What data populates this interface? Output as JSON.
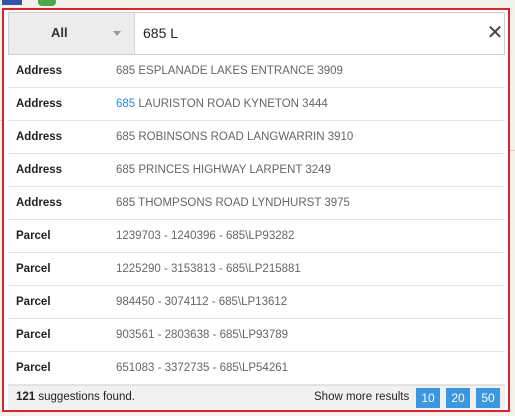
{
  "search": {
    "filter_label": "All",
    "query": "685 L",
    "clear_glyph": "✕"
  },
  "suggestions": [
    {
      "type": "Address",
      "match": "",
      "rest": "685 ESPLANADE LAKES ENTRANCE 3909"
    },
    {
      "type": "Address",
      "match": "685",
      "rest": " LAURISTON ROAD KYNETON 3444"
    },
    {
      "type": "Address",
      "match": "",
      "rest": "685 ROBINSONS ROAD LANGWARRIN 3910"
    },
    {
      "type": "Address",
      "match": "",
      "rest": "685 PRINCES HIGHWAY LARPENT 3249"
    },
    {
      "type": "Address",
      "match": "",
      "rest": "685 THOMPSONS ROAD LYNDHURST 3975"
    },
    {
      "type": "Parcel",
      "match": "",
      "rest": "1239703 - 1240396 - 685\\LP93282"
    },
    {
      "type": "Parcel",
      "match": "",
      "rest": "1225290 - 3153813 - 685\\LP215881"
    },
    {
      "type": "Parcel",
      "match": "",
      "rest": "984450 - 3074112 - 685\\LP13612"
    },
    {
      "type": "Parcel",
      "match": "",
      "rest": "903561 - 2803638 - 685\\LP93789"
    },
    {
      "type": "Parcel",
      "match": "",
      "rest": "651083 - 3372735 - 685\\LP54261"
    }
  ],
  "footer": {
    "count": "121",
    "count_suffix": " suggestions found.",
    "show_more_label": "Show more results",
    "page_sizes": [
      "10",
      "20",
      "50"
    ]
  },
  "colors": {
    "panel_border": "#d9232f",
    "match_highlight": "#2b8ad8",
    "page_button": "#3a97e0"
  }
}
